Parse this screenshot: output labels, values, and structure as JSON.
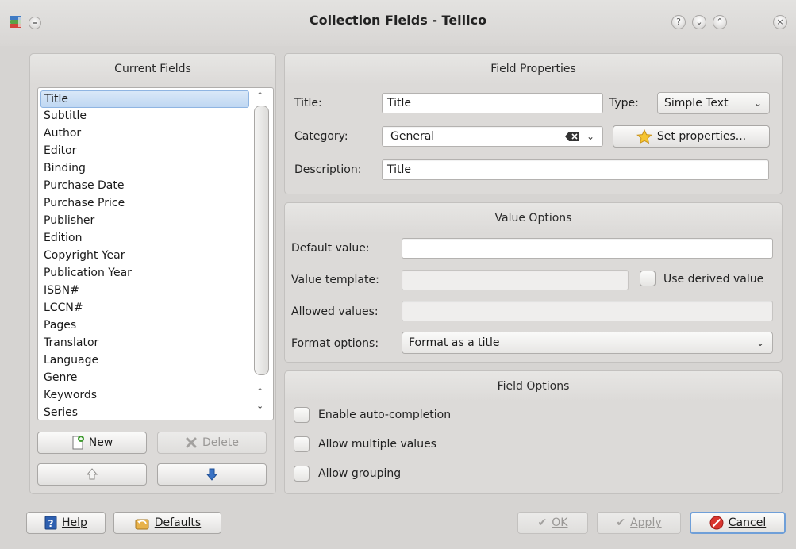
{
  "window": {
    "title": "Collection Fields - Tellico"
  },
  "current_fields": {
    "header": "Current Fields",
    "items": [
      "Title",
      "Subtitle",
      "Author",
      "Editor",
      "Binding",
      "Purchase Date",
      "Purchase Price",
      "Publisher",
      "Edition",
      "Copyright Year",
      "Publication Year",
      "ISBN#",
      "LCCN#",
      "Pages",
      "Translator",
      "Language",
      "Genre",
      "Keywords",
      "Series"
    ],
    "selected": "Title",
    "new_label": "New",
    "delete_label": "Delete"
  },
  "field_properties": {
    "header": "Field Properties",
    "title_label": "Title:",
    "title_value": "Title",
    "type_label": "Type:",
    "type_value": "Simple Text",
    "category_label": "Category:",
    "category_value": "General",
    "set_properties_label": "Set properties...",
    "description_label": "Description:",
    "description_value": "Title"
  },
  "value_options": {
    "header": "Value Options",
    "default_value_label": "Default value:",
    "default_value": "",
    "value_template_label": "Value template:",
    "value_template": "",
    "use_derived_label": "Use derived value",
    "allowed_values_label": "Allowed values:",
    "allowed_values": "",
    "format_options_label": "Format options:",
    "format_options_value": "Format as a title"
  },
  "field_options": {
    "header": "Field Options",
    "enable_autocompletion": "Enable auto-completion",
    "allow_multiple": "Allow multiple values",
    "allow_grouping": "Allow grouping"
  },
  "footer": {
    "help_label": "Help",
    "defaults_label": "Defaults",
    "ok_label": "OK",
    "apply_label": "Apply",
    "cancel_label": "Cancel"
  }
}
